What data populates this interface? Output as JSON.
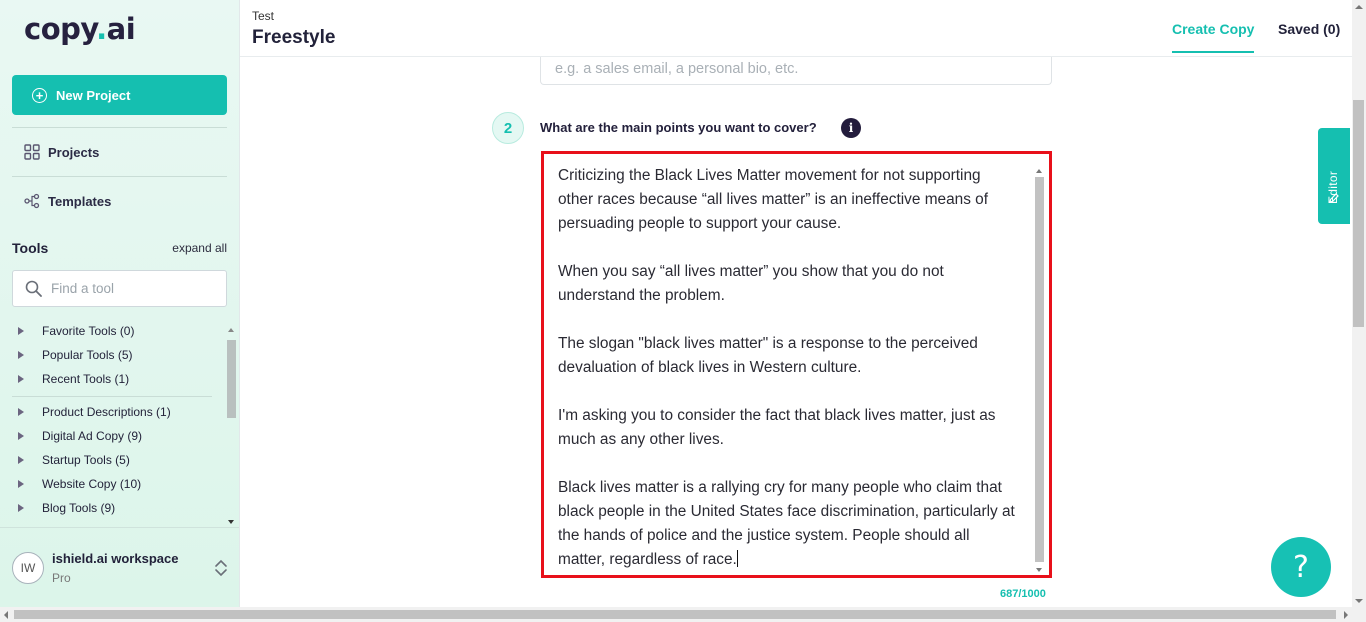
{
  "brand": {
    "logo_main": "copy",
    "logo_dot": ".",
    "logo_end": "ai",
    "accent": "#15bfb0"
  },
  "sidebar": {
    "new_project_label": "New Project",
    "nav": {
      "projects": "Projects",
      "templates": "Templates"
    },
    "tools_title": "Tools",
    "expand_all": "expand all",
    "search_placeholder": "Find a tool",
    "tool_groups": [
      "Favorite Tools (0)",
      "Popular Tools (5)",
      "Recent Tools (1)",
      "Product Descriptions (1)",
      "Digital Ad Copy (9)",
      "Startup Tools (5)",
      "Website Copy (10)",
      "Blog Tools (9)"
    ],
    "workspace": {
      "initials": "IW",
      "name": "ishield.ai workspace",
      "plan": "Pro"
    }
  },
  "header": {
    "breadcrumb": "Test",
    "title": "Freestyle",
    "tabs": {
      "create": "Create Copy",
      "saved": "Saved (0)"
    }
  },
  "form": {
    "prev_placeholder": "e.g. a sales email, a personal bio, etc.",
    "step_number": "2",
    "question": "What are the main points you want to cover?",
    "info_icon": "i",
    "paragraphs": [
      "Criticizing the Black Lives Matter movement for not supporting other races because “all lives matter” is an ineffective means of persuading people to support your cause.",
      "When you say “all lives matter” you show that you do not understand the problem.",
      "The slogan \"black lives matter\" is a response to the perceived devaluation of black lives in Western culture.",
      "I'm asking you to consider the fact that black lives matter, just as much as any other lives.",
      "Black lives matter is a rallying cry for many people who claim that black people in the United States face discrimination, particularly at the hands of police and the justice system. People should all matter, regardless of race."
    ],
    "char_count": "687/1000"
  },
  "editor_tab": "Editor",
  "help_label": "?"
}
